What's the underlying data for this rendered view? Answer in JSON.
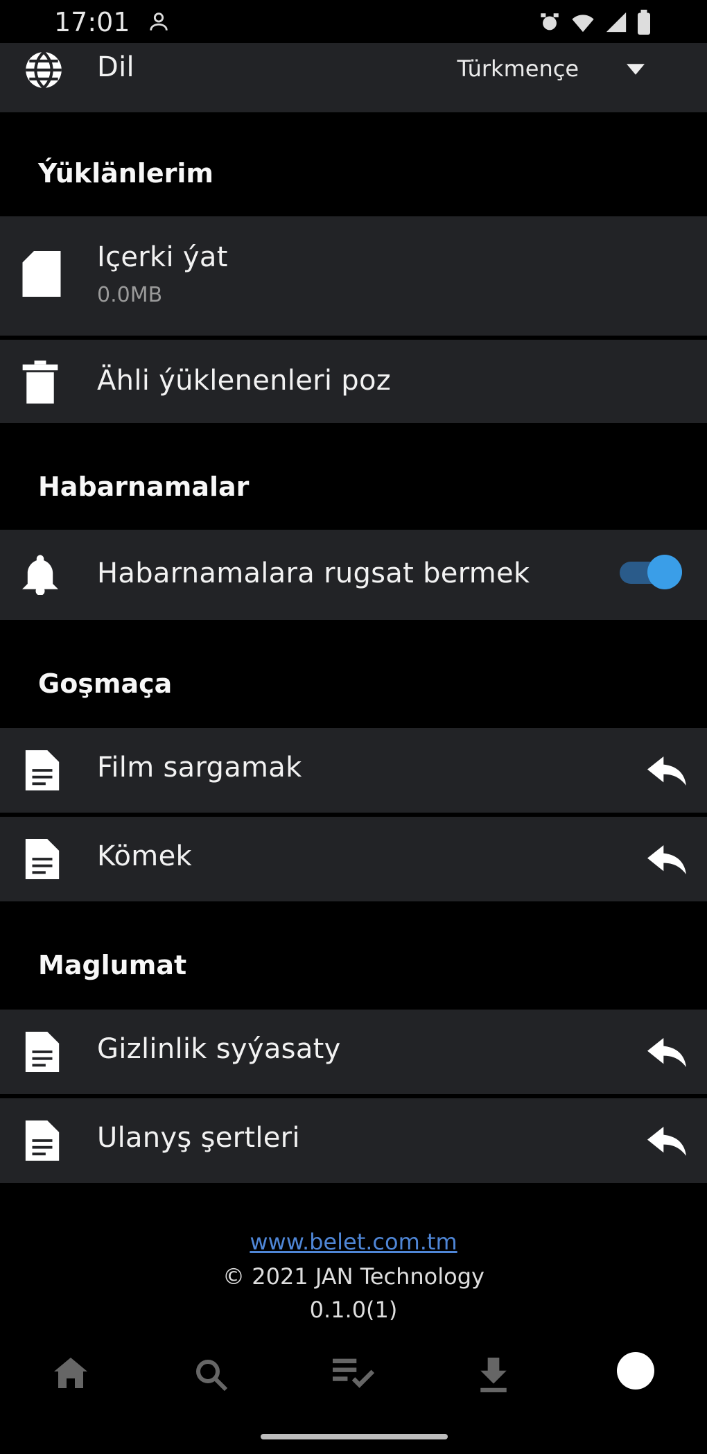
{
  "status": {
    "time": "17:01"
  },
  "language": {
    "label": "Dil",
    "value": "Türkmençe"
  },
  "sections": {
    "downloads": "Ýüklänlerim",
    "notifications": "Habarnamalar",
    "extras": "Goşmaça",
    "info": "Maglumat"
  },
  "downloads": {
    "content": {
      "label": "Içerki ýat",
      "size": "0.0MB"
    },
    "delete_all": "Ähli ýüklenenleri poz"
  },
  "notifications": {
    "allow_label": "Habarnamalara rugsat bermek",
    "enabled": true
  },
  "extras": [
    {
      "label": "Film sargamak"
    },
    {
      "label": "Kömek"
    }
  ],
  "info": [
    {
      "label": "Gizlinlik syýasaty"
    },
    {
      "label": "Ulanyş şertleri"
    }
  ],
  "footer": {
    "website": "www.belet.com.tm",
    "copyright": "© 2021 JAN Technology",
    "version": "0.1.0(1)"
  },
  "nav": [
    "home-icon",
    "search-icon",
    "playlist-check-icon",
    "download-icon",
    "profile-icon"
  ]
}
